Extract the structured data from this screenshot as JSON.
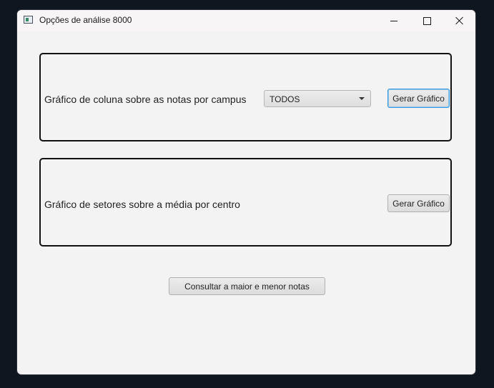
{
  "window": {
    "title": "Opções de análise 8000"
  },
  "panel_column": {
    "label": "Gráfico de coluna sobre as notas por campus",
    "combo_value": "TODOS",
    "button_label": "Gerar Gráfico"
  },
  "panel_pie": {
    "label": "Gráfico de setores sobre a média por centro",
    "button_label": "Gerar Gráfico"
  },
  "consult_button_label": "Consultar a maior e menor notas",
  "icons": {
    "app": "app-window-icon",
    "minimize": "minimize-icon",
    "maximize": "maximize-icon",
    "close": "close-icon",
    "dropdown": "chevron-down-icon"
  }
}
